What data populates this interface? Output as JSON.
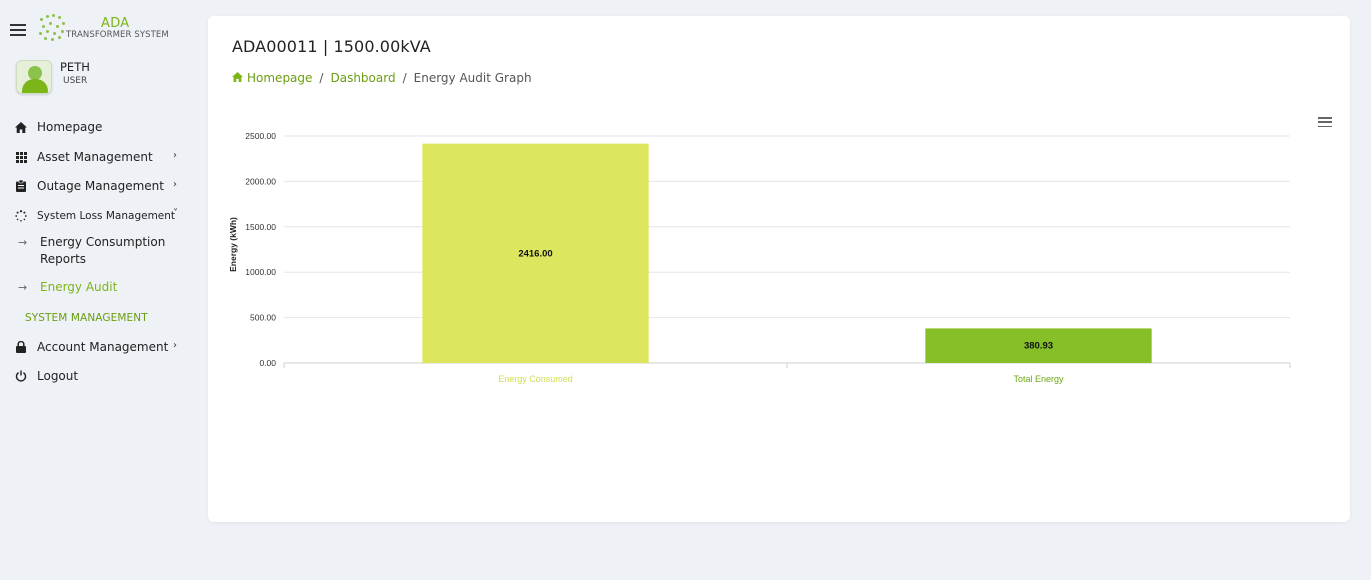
{
  "app": {
    "logo_title": "ADA",
    "logo_subtitle": "TRANSFORMER SYSTEM"
  },
  "user": {
    "name": "PETH",
    "role": "USER"
  },
  "sidebar": {
    "items": [
      {
        "label": "Homepage",
        "icon": "home-icon"
      },
      {
        "label": "Asset Management",
        "icon": "grid-icon"
      },
      {
        "label": "Outage Management",
        "icon": "clipboard-icon"
      },
      {
        "label": "System Loss Management",
        "icon": "loader-icon"
      }
    ],
    "sub_items": [
      {
        "label": "Energy Consumption Reports",
        "active": false
      },
      {
        "label": "Energy Audit",
        "active": true
      }
    ],
    "section_title": "SYSTEM MANAGEMENT",
    "account_label": "Account Management",
    "logout_label": "Logout"
  },
  "header": {
    "title": "ADA00011 | 1500.00kVA",
    "breadcrumb": [
      "Homepage",
      "Dashboard",
      "Energy Audit Graph"
    ]
  },
  "colors": {
    "accent": "#7cb518",
    "bar1": "#dce65f",
    "bar2": "#86bf28"
  },
  "chart_data": {
    "type": "bar",
    "categories": [
      "Energy Consumed",
      "Total Energy"
    ],
    "values": [
      2416.0,
      380.93
    ],
    "value_labels": [
      "2416.00",
      "380.93"
    ],
    "ylabel": "Energy (kWh)",
    "ylim": [
      0,
      2500
    ],
    "yticks": [
      "0.00",
      "500.00",
      "1000.00",
      "1500.00",
      "2000.00",
      "2500.00"
    ],
    "grid": true
  }
}
